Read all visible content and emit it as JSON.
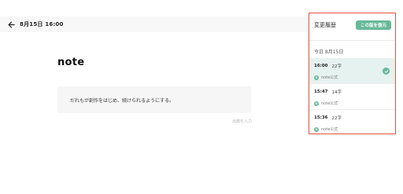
{
  "header": {
    "back_icon": "arrow-left-icon",
    "date_label": "8月15日 16:00"
  },
  "editor": {
    "title": "note",
    "quote_text": "だれもが創作をはじめ、続けられるようにする。",
    "source_placeholder": "出典を入力"
  },
  "history_panel": {
    "title": "変更履歴",
    "restore_button": "この版を復元",
    "section_date": "今日 8月15日",
    "accent_color": "#68b999",
    "border_color": "#e5533d",
    "versions": [
      {
        "time": "16:00",
        "chars": "22字",
        "author": "note公式",
        "avatar": "n",
        "selected": true
      },
      {
        "time": "15:47",
        "chars": "14字",
        "author": "note公式",
        "avatar": "n",
        "selected": false
      },
      {
        "time": "15:36",
        "chars": "22字",
        "author": "note公式",
        "avatar": "n",
        "selected": false
      }
    ]
  }
}
